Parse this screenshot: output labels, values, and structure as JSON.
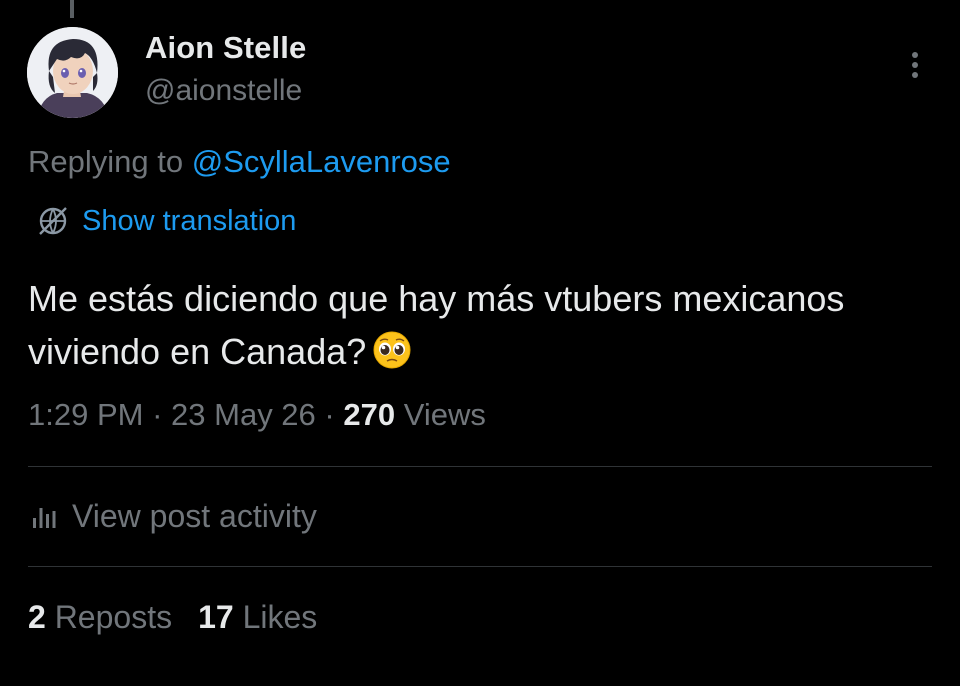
{
  "author": {
    "display_name": "Aion Stelle",
    "handle": "@aionstelle",
    "avatar": "anime-character-avatar"
  },
  "reply": {
    "prefix": "Replying to",
    "mention": "@ScyllaLavenrose"
  },
  "translation": {
    "label": "Show translation",
    "icon": "globe-icon"
  },
  "post": {
    "text": "Me estás diciendo que hay más vtubers mexicanos viviendo en Canada?",
    "emoji": "pleading-face"
  },
  "meta": {
    "time": "1:29 PM",
    "date": "23 May 26",
    "views_count": "270",
    "views_label": "Views",
    "separator": "·"
  },
  "activity": {
    "label": "View post activity",
    "icon": "bar-chart-icon"
  },
  "stats": {
    "reposts_count": "2",
    "reposts_label": "Reposts",
    "likes_count": "17",
    "likes_label": "Likes"
  },
  "colors": {
    "background": "#000000",
    "primary_text": "#e7e9ea",
    "secondary_text": "#71767b",
    "accent": "#1d9bf0",
    "divider": "#2f3336"
  }
}
